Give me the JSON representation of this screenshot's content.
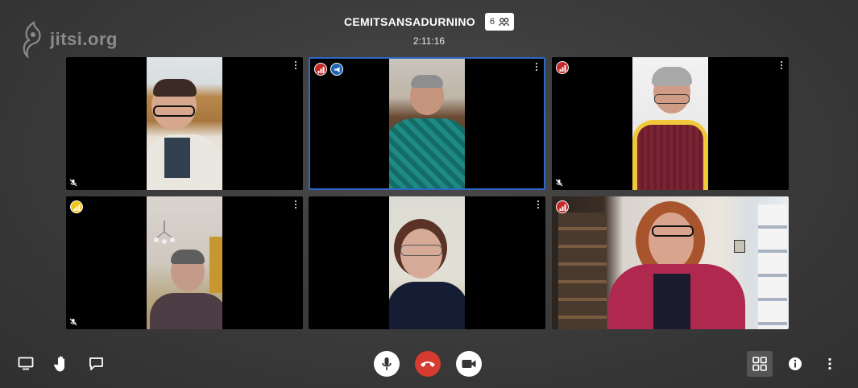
{
  "brand": {
    "name": "jitsi.org"
  },
  "meeting": {
    "title": "CEMITSANSADURNINO",
    "participant_count": "6",
    "elapsed": "2:11:16"
  },
  "participants": [
    {
      "position": "top-left",
      "muted": true,
      "connection": "none",
      "active_speaker": false
    },
    {
      "position": "top-center",
      "muted": false,
      "connection": "poor",
      "active_speaker": true,
      "speaker_badge": true
    },
    {
      "position": "top-right",
      "muted": true,
      "connection": "poor",
      "active_speaker": false
    },
    {
      "position": "bottom-left",
      "muted": true,
      "connection": "weak",
      "active_speaker": false
    },
    {
      "position": "bottom-center",
      "muted": false,
      "connection": "none",
      "active_speaker": false
    },
    {
      "position": "bottom-right",
      "muted": false,
      "connection": "poor",
      "active_speaker": false
    }
  ],
  "toolbar": {
    "left": [
      "screen-share-icon",
      "raise-hand-icon",
      "chat-icon"
    ],
    "center": [
      "microphone-icon",
      "hangup-icon",
      "camera-icon"
    ],
    "right": [
      "tile-view-icon",
      "info-icon",
      "more-options-icon"
    ]
  },
  "colors": {
    "active_border": "#2e68c5",
    "hangup": "#d63b2f",
    "poor_connection": "#c62828",
    "weak_connection": "#f2c617",
    "speaker_badge": "#1e63b6"
  }
}
